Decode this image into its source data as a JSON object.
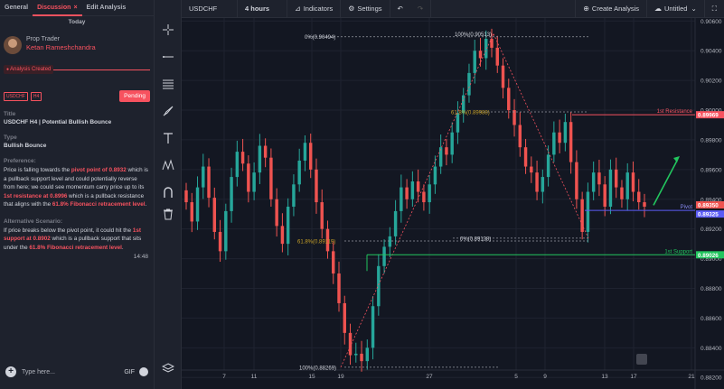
{
  "tabs": [
    {
      "label": "General"
    },
    {
      "label": "Discussion",
      "close": "×"
    },
    {
      "label": "Edit Analysis"
    }
  ],
  "today": "Today",
  "author": {
    "role": "Prop Trader",
    "name": "Ketan Rameshchandra"
  },
  "status": {
    "created": "Analysis Created"
  },
  "tags": [
    "USDCHF",
    "H4"
  ],
  "pending": "Pending",
  "title": {
    "label": "Title",
    "value": "USDCHF H4 | Potential Bullish Bounce"
  },
  "type": {
    "label": "Type",
    "value": "Bullish Bounce"
  },
  "preference": {
    "label": "Preference:"
  },
  "alternative": {
    "label": "Alternative Scenario:"
  },
  "time": "14:48",
  "input": {
    "placeholder": "Type here...",
    "gif": "GIF"
  },
  "topbar": {
    "symbol": "USDCHF",
    "timeframe": "4 hours",
    "indicators": "Indicators",
    "settings": "Settings",
    "create_analysis": "Create Analysis",
    "layout": "Untitled"
  },
  "icons": {
    "crosshair": "crosshair-icon",
    "trendline": "horizontal-line-icon",
    "fib": "fib-retracement-icon",
    "brush": "brush-icon",
    "text": "text-icon",
    "pattern": "pattern-icon",
    "magnet": "magnet-icon",
    "trash": "trash-icon",
    "layers": "layers-icon"
  },
  "colors": {
    "accent": "#f7525f",
    "bull": "#26a69a",
    "bear": "#ef5350",
    "resistance": "#f7525f",
    "support": "#22c55e",
    "pivot": "#5b5cf6"
  },
  "chart_data": {
    "type": "candlestick",
    "symbol": "USDCHF",
    "timeframe": "4 hours",
    "ylim": [
      0.8825,
      0.9062
    ],
    "y_ticks": [
      "0.90600",
      "0.90400",
      "0.90200",
      "0.90000",
      "0.89800",
      "0.89600",
      "0.89400",
      "0.89200",
      "0.89000",
      "0.88800",
      "0.88600",
      "0.88400",
      "0.88200"
    ],
    "x_ticks": [
      "7",
      "11",
      "15",
      "19",
      "27",
      "5",
      "9",
      "13",
      "17",
      "21"
    ],
    "levels": [
      {
        "name": "1st Resistance",
        "price": 0.89969,
        "label": "0.89969"
      },
      {
        "name": "Pivot",
        "price": 0.89325,
        "label": "0.89325"
      },
      {
        "name": "",
        "price": 0.8935,
        "label": "0.89350"
      },
      {
        "name": "1st Support",
        "price": 0.89026,
        "label": "0.89026"
      }
    ],
    "fib_labels": [
      "0%(0.90494)",
      "100%(0.90513)",
      "61.8%(0.89988)",
      "61.8%(0.89119)",
      "0%(0.89138)",
      "100%(0.88269)"
    ],
    "close_series": [
      0.8938,
      0.8925,
      0.8948,
      0.8962,
      0.8941,
      0.8918,
      0.8905,
      0.8932,
      0.8955,
      0.8972,
      0.8964,
      0.8945,
      0.8958,
      0.8976,
      0.8968,
      0.894,
      0.8922,
      0.891,
      0.8935,
      0.895,
      0.8966,
      0.8978,
      0.896,
      0.8938,
      0.892,
      0.8905,
      0.889,
      0.887,
      0.885,
      0.8835,
      0.8836,
      0.8831,
      0.884,
      0.8868,
      0.8895,
      0.8908,
      0.8915,
      0.8932,
      0.8948,
      0.894,
      0.8952,
      0.8945,
      0.8938,
      0.895,
      0.8962,
      0.8975,
      0.897,
      0.8985,
      0.8998,
      0.901,
      0.9025,
      0.904,
      0.9035,
      0.9048,
      0.9042,
      0.903,
      0.9015,
      0.9,
      0.899,
      0.8975,
      0.8962,
      0.8958,
      0.8945,
      0.8955,
      0.897,
      0.8985,
      0.8978,
      0.8992,
      0.8965,
      0.894,
      0.8918,
      0.8945,
      0.8958,
      0.895,
      0.8935,
      0.896,
      0.8948,
      0.894,
      0.8958,
      0.8945,
      0.8938,
      0.8935
    ]
  }
}
